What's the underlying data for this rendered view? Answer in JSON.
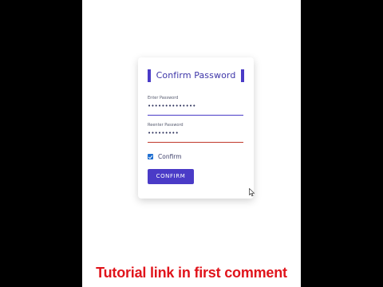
{
  "form": {
    "title": "Confirm Password",
    "password_label": "Enter Password",
    "password_value": "••••••••••••••",
    "reenter_label": "Reenter Password",
    "reenter_value": "•••••••••",
    "confirm_checkbox_label": "Confirm",
    "confirm_checked": true,
    "confirm_button_label": "CONFIRM"
  },
  "caption": "Tutorial link in first comment",
  "colors": {
    "accent": "#4a3bc7",
    "error_underline": "#c0392b",
    "checkbox": "#1f6fd1",
    "caption_red": "#e0141b",
    "letterbox": "#000000",
    "page_background": "#ffffff"
  },
  "icons": {
    "cursor": "mouse-pointer-icon",
    "checkbox": "checkmark-icon"
  }
}
